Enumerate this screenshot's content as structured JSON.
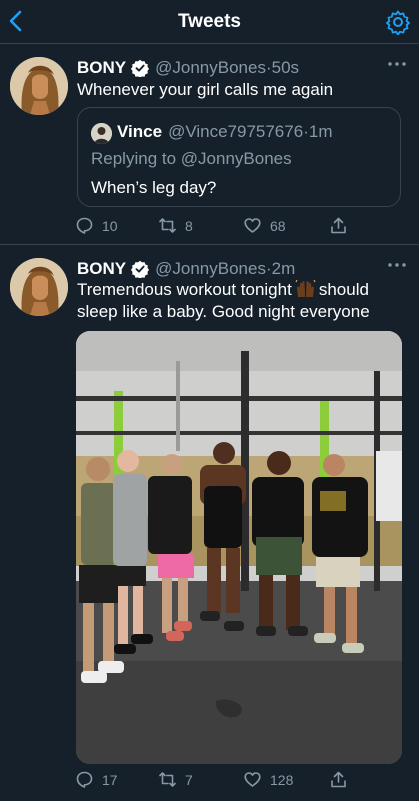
{
  "header": {
    "title": "Tweets"
  },
  "tweets": [
    {
      "name": "BONY",
      "handle": "@JonnyBones",
      "time": "50s",
      "text": "Whenever your girl calls me again",
      "quote": {
        "name": "Vince",
        "handle": "@Vince79757676",
        "time": "1m",
        "reply_prefix": "Replying to ",
        "reply_to": "@JonnyBones",
        "text": "When’s leg day?"
      },
      "replies": "10",
      "retweets": "8",
      "likes": "68"
    },
    {
      "name": "BONY",
      "handle": "@JonnyBones",
      "time": "2m",
      "text_before": "Tremendous workout tonight",
      "text_emoji": "raised-hands-emoji",
      "text_after": "should",
      "text_line2": "sleep like a baby. Good night everyone",
      "replies": "17",
      "retweets": "7",
      "likes": "128"
    }
  ],
  "separator": " · ",
  "colors": {
    "background": "#15202b",
    "accent": "#1da1f2",
    "muted": "#8899a6",
    "border": "#38444d"
  }
}
